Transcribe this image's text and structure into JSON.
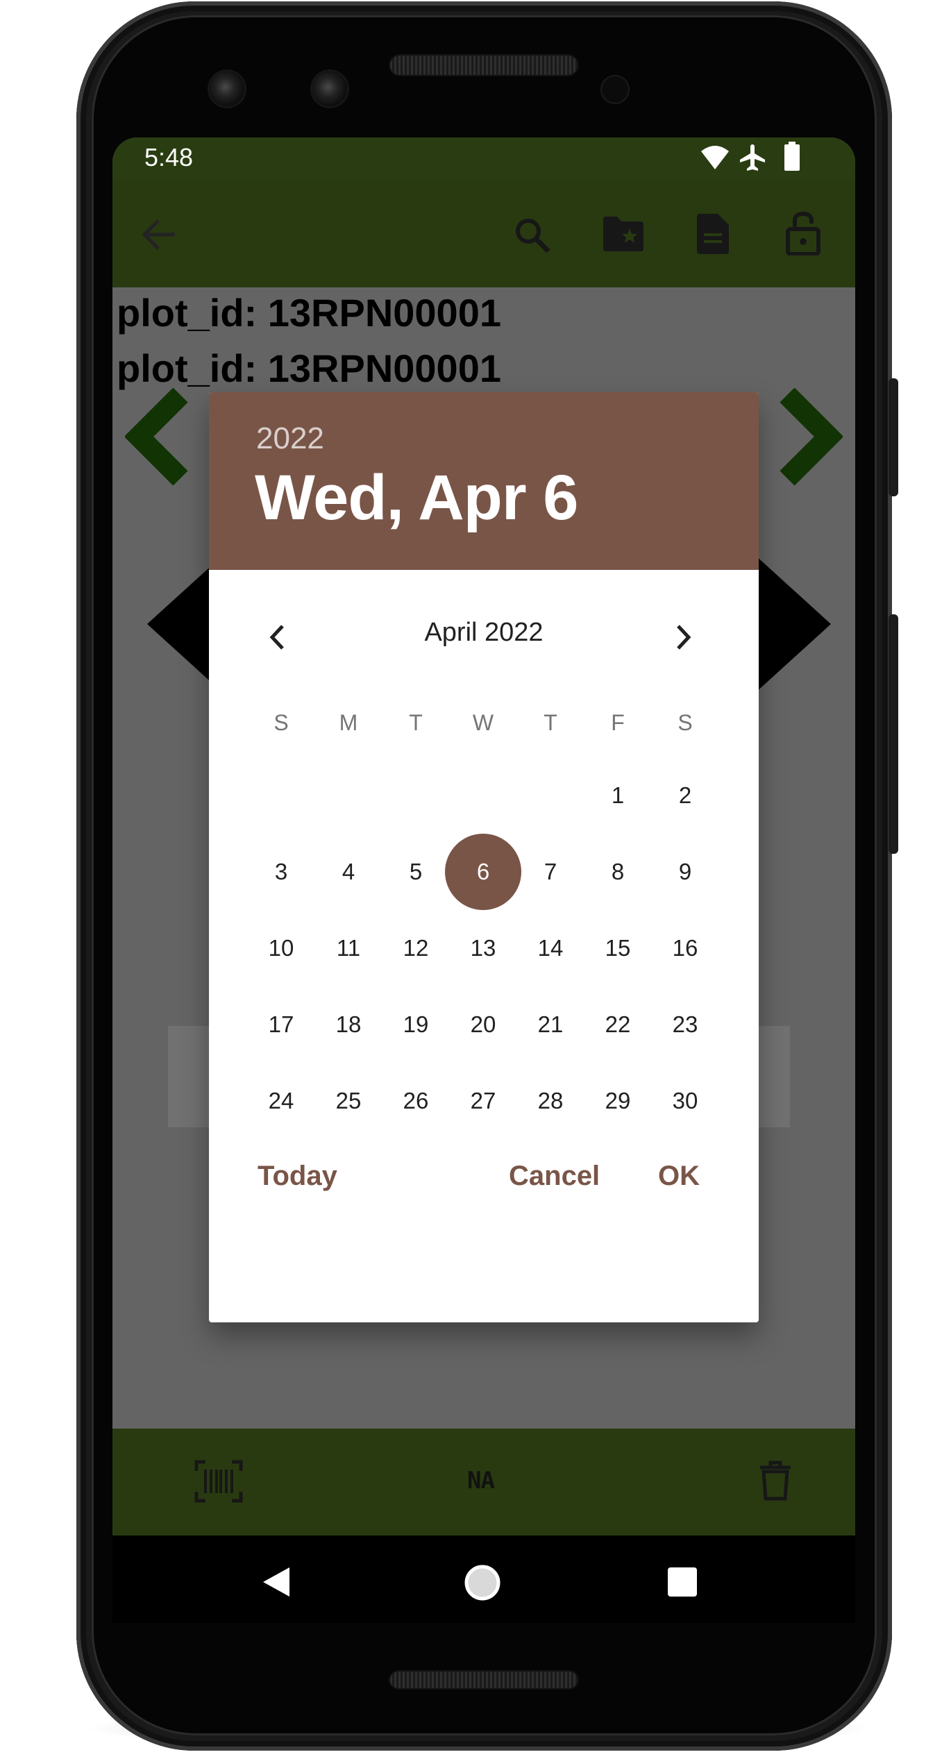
{
  "status_bar": {
    "time": "5:48",
    "icons": [
      "wifi-icon",
      "airplane-icon",
      "battery-icon"
    ]
  },
  "app_bar": {
    "icons": [
      "back-arrow-icon",
      "search-icon",
      "folder-star-icon",
      "document-icon",
      "unlock-icon"
    ]
  },
  "content": {
    "plot_lines": [
      "plot_id: 13RPN00001",
      "plot_id: 13RPN00001"
    ]
  },
  "date_picker": {
    "header_year": "2022",
    "header_date": "Wed, Apr 6",
    "month_label": "April 2022",
    "weekdays": [
      "S",
      "M",
      "T",
      "W",
      "T",
      "F",
      "S"
    ],
    "weeks": [
      [
        "",
        "",
        "",
        "",
        "",
        "1",
        "2"
      ],
      [
        "3",
        "4",
        "5",
        "6",
        "7",
        "8",
        "9"
      ],
      [
        "10",
        "11",
        "12",
        "13",
        "14",
        "15",
        "16"
      ],
      [
        "17",
        "18",
        "19",
        "20",
        "21",
        "22",
        "23"
      ],
      [
        "24",
        "25",
        "26",
        "27",
        "28",
        "29",
        "30"
      ]
    ],
    "selected_day": "6",
    "buttons": {
      "today": "Today",
      "cancel": "Cancel",
      "ok": "OK"
    }
  },
  "bottom_bar": {
    "na_label": "NA",
    "icons": [
      "barcode-scan-icon",
      "delete-icon"
    ]
  },
  "nav_bar": {
    "icons": [
      "nav-back-icon",
      "nav-home-icon",
      "nav-recents-icon"
    ]
  },
  "colors": {
    "app_bar": "#3b5319",
    "status_bar": "#2a3d12",
    "dialog_accent": "#795548",
    "nav_arrow_green": "#1b4a06"
  }
}
